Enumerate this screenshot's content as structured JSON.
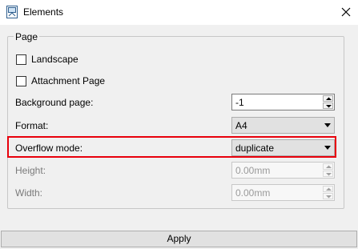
{
  "window": {
    "title": "Elements",
    "close_icon": "close-icon",
    "app_icon": "document-icon"
  },
  "page_group": {
    "title": "Page",
    "landscape": {
      "label": "Landscape",
      "checked": false
    },
    "attachment_page": {
      "label": "Attachment Page",
      "checked": false
    },
    "background_page": {
      "label": "Background page:",
      "value": "-1"
    },
    "format": {
      "label": "Format:",
      "value": "A4"
    },
    "overflow_mode": {
      "label": "Overflow mode:",
      "value": "duplicate",
      "highlight_color": "#e8000b"
    },
    "height": {
      "label": "Height:",
      "value": "0.00mm",
      "enabled": false
    },
    "width": {
      "label": "Width:",
      "value": "0.00mm",
      "enabled": false
    }
  },
  "apply_label": "Apply"
}
